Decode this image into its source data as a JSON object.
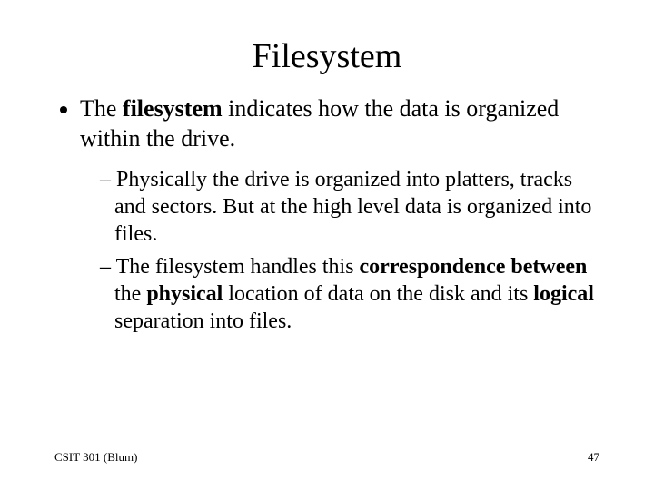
{
  "title": "Filesystem",
  "bullet1_pre": "The ",
  "bullet1_bold": "filesystem",
  "bullet1_post": " indicates how the data is organized within the drive.",
  "sub1": "Physically the drive is organized into platters, tracks and sectors. But at the high level data is organized into files.",
  "sub2_a": "The filesystem handles this ",
  "sub2_b": "correspondence between",
  "sub2_c": " the ",
  "sub2_d": "physical",
  "sub2_e": " location of data on the disk and its ",
  "sub2_f": "logical",
  "sub2_g": " separation into files.",
  "footer_left": "CSIT 301 (Blum)",
  "footer_right": "47"
}
